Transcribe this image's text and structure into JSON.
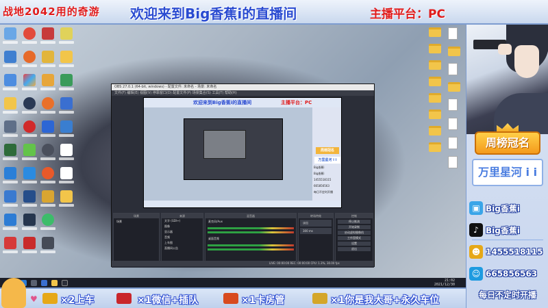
{
  "banner": {
    "left_text": "战地2042用的奇游",
    "center_text": "欢迎来到Big香蕉i的直播间",
    "right_text": "主播平台：PC"
  },
  "obs": {
    "title": "OBS 27.0.1 (64-bit, windows) - 配置文件: 未命名 - 场景: 未命名",
    "menu": "文件(F)  编辑(E)  视图(V)  停靠窗口(D)  配置文件(P)  场景集合(S)  工具(T)  帮助(H)",
    "preview_banner_center": "欢迎来到Big香蕉i的直播间",
    "preview_banner_right": "主播平台：PC",
    "preview_crown": "周榜冠名",
    "preview_name": "万里星河 i i",
    "preview_rows": [
      "Big香蕉i",
      "Big香蕉i",
      "1455518115",
      "665856563",
      "每日不定时开播"
    ],
    "docks": [
      "场景",
      "来源",
      "混音器",
      "转场特效",
      "控制"
    ],
    "scene_item": "场景",
    "sources": [
      "文字 (GDI+)",
      "图像",
      "显示器",
      "音频",
      "上车图",
      "直播间公告"
    ],
    "mixer_items": [
      "麦克风/Aux",
      "桌面音频"
    ],
    "transition": "淡出",
    "transition_duration": "300 ms",
    "controls": [
      "停止推流",
      "开始录制",
      "启动虚拟摄像机",
      "工作室模式",
      "设置",
      "退出"
    ],
    "status": "LIVE: 00:00:00   REC: 00:00:00   CPU: 1.3%, 30.00 fps"
  },
  "taskbar": {
    "time": "21:02",
    "date": "2021/12/30"
  },
  "gifts": [
    {
      "label": "×2上车",
      "color": "#e6a817"
    },
    {
      "label": "×1微信+插队",
      "color": "#c9262b"
    },
    {
      "label": "×1卡房管",
      "color": "#d84a1f"
    },
    {
      "label": "×1你是我大哥+永久车位",
      "color": "#d4a62a"
    }
  ],
  "sidebar": {
    "crown_title": "周榜冠名",
    "crown_name": "万里星河 i i",
    "rows": [
      {
        "icon": "bilibili-icon",
        "text": "Big香蕉i",
        "color": "#3aa5e8"
      },
      {
        "icon": "douyin-icon",
        "text": "Big香蕉i",
        "color": "#111111"
      },
      {
        "icon": "wechat-icon",
        "text": "1455518115",
        "color": "#e6a817"
      },
      {
        "icon": "qq-icon",
        "text": "665856563",
        "color": "#1f9be0"
      }
    ],
    "schedule": "每日不定时开播"
  }
}
